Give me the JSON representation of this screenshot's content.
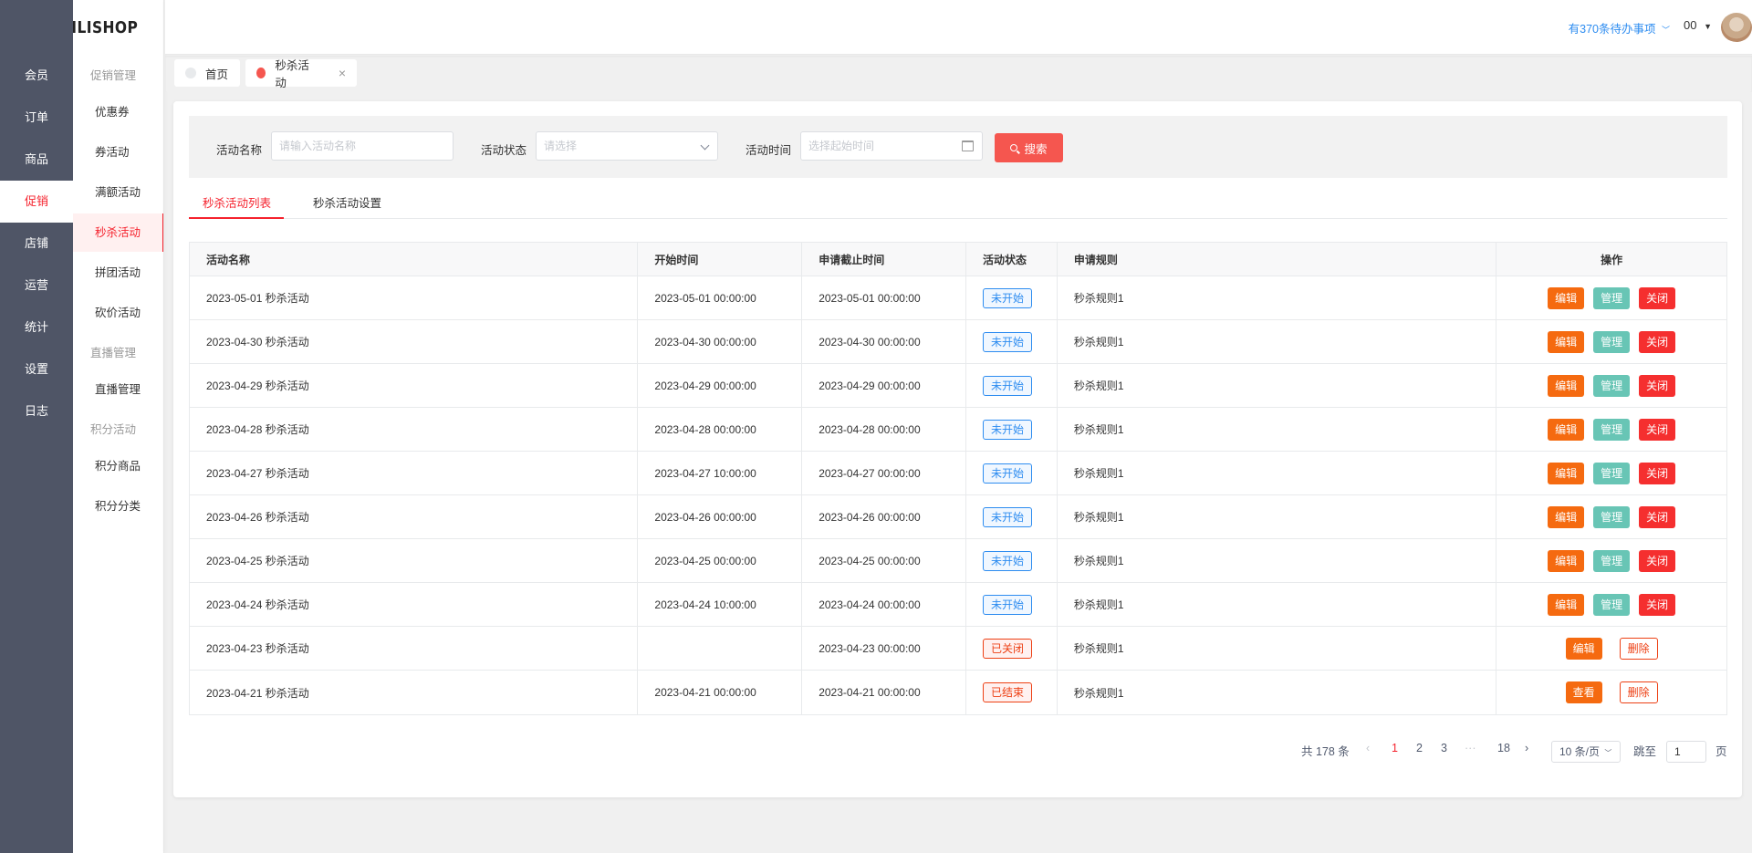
{
  "brand": {
    "name": "LILISHOP"
  },
  "header": {
    "todo": "有370条待办事项",
    "user": "00"
  },
  "primary_nav": [
    {
      "label": "会员"
    },
    {
      "label": "订单"
    },
    {
      "label": "商品"
    },
    {
      "label": "促销",
      "active": true
    },
    {
      "label": "店铺"
    },
    {
      "label": "运营"
    },
    {
      "label": "统计"
    },
    {
      "label": "设置"
    },
    {
      "label": "日志"
    }
  ],
  "secondary_nav": {
    "groups": [
      "促销管理",
      "直播管理",
      "积分活动"
    ],
    "links": [
      "优惠券",
      "券活动",
      "满额活动",
      "秒杀活动",
      "拼团活动",
      "砍价活动",
      "直播管理",
      "积分商品",
      "积分分类"
    ]
  },
  "tabs": [
    {
      "label": "首页",
      "dot_color": "#e8eaec"
    },
    {
      "label": "秒杀活动",
      "dot_color": "#f5564f",
      "closable": true
    }
  ],
  "filters": {
    "name_label": "活动名称",
    "name_placeholder": "请输入活动名称",
    "status_label": "活动状态",
    "status_placeholder": "请选择",
    "time_label": "活动时间",
    "time_placeholder": "选择起始时间",
    "search_label": "搜索"
  },
  "subtabs": [
    "秒杀活动列表",
    "秒杀活动设置"
  ],
  "table": {
    "headers": [
      "活动名称",
      "开始时间",
      "申请截止时间",
      "活动状态",
      "申请规则",
      "操作"
    ],
    "rows": [
      {
        "name": "2023-05-01 秒杀活动",
        "start": "2023-05-01 00:00:00",
        "deadline": "2023-05-01 00:00:00",
        "status": "未开始",
        "rule": "秒杀规则1",
        "actions": [
          "编辑",
          "管理",
          "关闭"
        ]
      },
      {
        "name": "2023-04-30 秒杀活动",
        "start": "2023-04-30 00:00:00",
        "deadline": "2023-04-30 00:00:00",
        "status": "未开始",
        "rule": "秒杀规则1",
        "actions": [
          "编辑",
          "管理",
          "关闭"
        ]
      },
      {
        "name": "2023-04-29 秒杀活动",
        "start": "2023-04-29 00:00:00",
        "deadline": "2023-04-29 00:00:00",
        "status": "未开始",
        "rule": "秒杀规则1",
        "actions": [
          "编辑",
          "管理",
          "关闭"
        ]
      },
      {
        "name": "2023-04-28 秒杀活动",
        "start": "2023-04-28 00:00:00",
        "deadline": "2023-04-28 00:00:00",
        "status": "未开始",
        "rule": "秒杀规则1",
        "actions": [
          "编辑",
          "管理",
          "关闭"
        ]
      },
      {
        "name": "2023-04-27 秒杀活动",
        "start": "2023-04-27 10:00:00",
        "deadline": "2023-04-27 00:00:00",
        "status": "未开始",
        "rule": "秒杀规则1",
        "actions": [
          "编辑",
          "管理",
          "关闭"
        ]
      },
      {
        "name": "2023-04-26 秒杀活动",
        "start": "2023-04-26 00:00:00",
        "deadline": "2023-04-26 00:00:00",
        "status": "未开始",
        "rule": "秒杀规则1",
        "actions": [
          "编辑",
          "管理",
          "关闭"
        ]
      },
      {
        "name": "2023-04-25 秒杀活动",
        "start": "2023-04-25 00:00:00",
        "deadline": "2023-04-25 00:00:00",
        "status": "未开始",
        "rule": "秒杀规则1",
        "actions": [
          "编辑",
          "管理",
          "关闭"
        ]
      },
      {
        "name": "2023-04-24 秒杀活动",
        "start": "2023-04-24 10:00:00",
        "deadline": "2023-04-24 00:00:00",
        "status": "未开始",
        "rule": "秒杀规则1",
        "actions": [
          "编辑",
          "管理",
          "关闭"
        ]
      },
      {
        "name": "2023-04-23 秒杀活动",
        "start": "",
        "deadline": "2023-04-23 00:00:00",
        "status": "已关闭",
        "rule": "秒杀规则1",
        "actions": [
          "编辑",
          "删除"
        ]
      },
      {
        "name": "2023-04-21 秒杀活动",
        "start": "2023-04-21 00:00:00",
        "deadline": "2023-04-21 00:00:00",
        "status": "已结束",
        "rule": "秒杀规则1",
        "actions": [
          "查看",
          "删除"
        ]
      }
    ]
  },
  "pagination": {
    "total": "共 178 条",
    "pages": [
      "1",
      "2",
      "3",
      "···",
      "18"
    ],
    "current": "1",
    "page_size": "10 条/页",
    "jump_label": "跳至",
    "jump_value": "1",
    "page_unit": "页"
  },
  "colors": {
    "accent": "#f5222d",
    "edit": "#f56a10",
    "manage": "#68c5b5",
    "close": "#f52f2f",
    "status_blue": "#2d8cf0"
  }
}
